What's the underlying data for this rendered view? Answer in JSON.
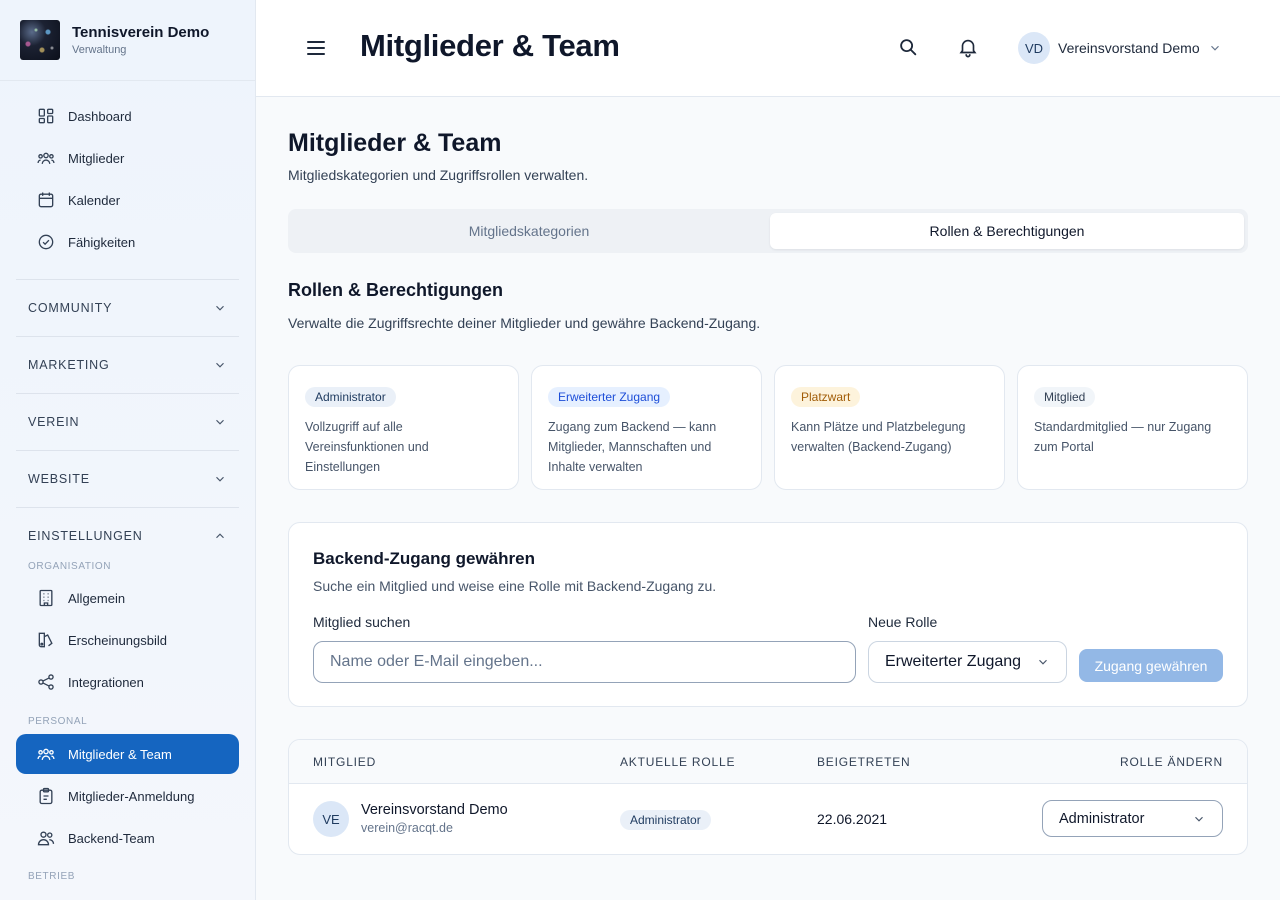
{
  "brand": {
    "title": "Tennisverein Demo",
    "subtitle": "Verwaltung"
  },
  "sidebar": {
    "main_items": [
      {
        "label": "Dashboard",
        "icon": "dashboard-icon"
      },
      {
        "label": "Mitglieder",
        "icon": "users-icon"
      },
      {
        "label": "Kalender",
        "icon": "calendar-icon"
      },
      {
        "label": "Fähigkeiten",
        "icon": "check-circle-icon"
      }
    ],
    "groups": [
      {
        "label": "COMMUNITY",
        "expanded": false
      },
      {
        "label": "MARKETING",
        "expanded": false
      },
      {
        "label": "VEREIN",
        "expanded": false
      },
      {
        "label": "WEBSITE",
        "expanded": false
      },
      {
        "label": "EINSTELLUNGEN",
        "expanded": true
      }
    ],
    "sub_org": "ORGANISATION",
    "org_items": [
      {
        "label": "Allgemein",
        "icon": "building-icon"
      },
      {
        "label": "Erscheinungsbild",
        "icon": "palette-icon"
      },
      {
        "label": "Integrationen",
        "icon": "share-icon"
      }
    ],
    "sub_personal": "PERSONAL",
    "personal_items": [
      {
        "label": "Mitglieder & Team",
        "icon": "users-icon",
        "active": true
      },
      {
        "label": "Mitglieder-Anmeldung",
        "icon": "clipboard-icon"
      },
      {
        "label": "Backend-Team",
        "icon": "team-icon"
      }
    ],
    "sub_betrieb": "BETRIEB"
  },
  "header": {
    "title": "Mitglieder & Team",
    "user_initials": "VD",
    "user_name": "Vereinsvorstand Demo"
  },
  "page": {
    "title": "Mitglieder & Team",
    "subtitle": "Mitgliedskategorien und Zugriffsrollen verwalten.",
    "tabs": [
      {
        "label": "Mitgliedskategorien",
        "active": false
      },
      {
        "label": "Rollen & Berechtigungen",
        "active": true
      }
    ],
    "section_title": "Rollen & Berechtigungen",
    "section_subtitle": "Verwalte die Zugriffsrechte deiner Mitglieder und gewähre Backend-Zugang."
  },
  "roles": [
    {
      "name": "Administrator",
      "style": "admin",
      "description": "Vollzugriff auf alle Vereinsfunktionen und Einstellungen"
    },
    {
      "name": "Erweiterter Zugang",
      "style": "ext",
      "description": "Zugang zum Backend — kann Mitglieder, Mannschaften und Inhalte verwalten"
    },
    {
      "name": "Platzwart",
      "style": "platz",
      "description": "Kann Plätze und Platzbelegung verwalten (Backend-Zugang)"
    },
    {
      "name": "Mitglied",
      "style": "member",
      "description": "Standardmitglied — nur Zugang zum Portal"
    }
  ],
  "access": {
    "title": "Backend-Zugang gewähren",
    "subtitle": "Suche ein Mitglied und weise eine Rolle mit Backend-Zugang zu.",
    "search_label": "Mitglied suchen",
    "search_placeholder": "Name oder E-Mail eingeben...",
    "search_value": "",
    "role_label": "Neue Rolle",
    "role_value": "Erweiterter Zugang",
    "button_label": "Zugang gewähren"
  },
  "table": {
    "columns": [
      "MITGLIED",
      "AKTUELLE ROLLE",
      "BEIGETRETEN",
      "ROLLE ÄNDERN"
    ],
    "rows": [
      {
        "initials": "VE",
        "name": "Vereinsvorstand Demo",
        "email": "verein@racqt.de",
        "role": "Administrator",
        "joined": "22.06.2021",
        "role_select": "Administrator"
      }
    ]
  },
  "colors": {
    "accent": "#1565c0",
    "button_disabled": "#93b8e6"
  }
}
